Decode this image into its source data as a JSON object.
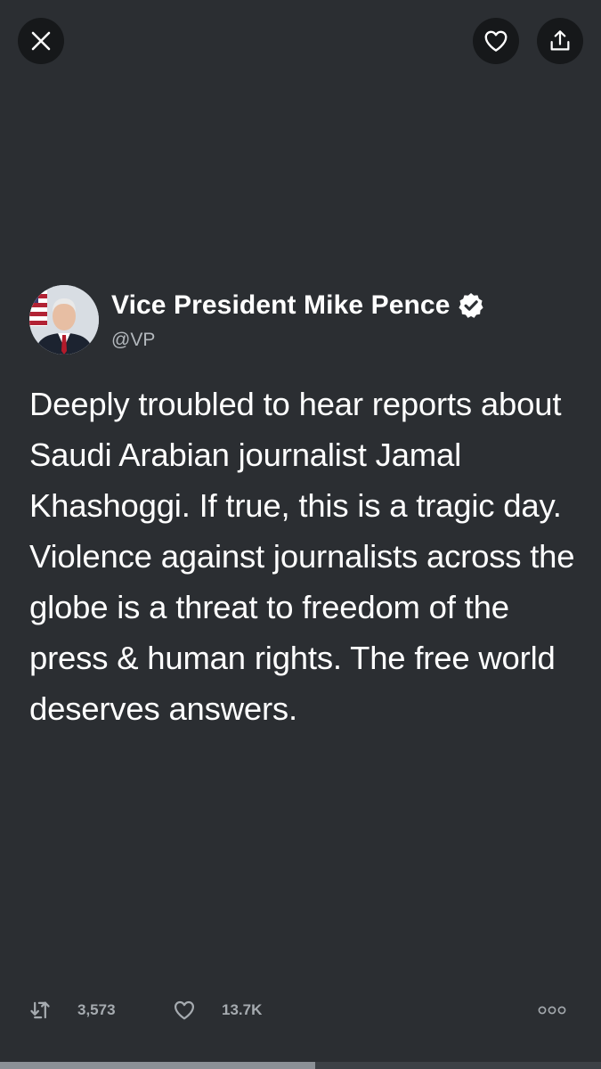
{
  "header": {
    "close_icon": "close-icon",
    "like_icon": "heart-icon",
    "share_icon": "share-icon"
  },
  "tweet": {
    "author": {
      "display_name": "Vice President Mike Pence",
      "handle": "@VP",
      "verified": true
    },
    "text": "Deeply troubled to hear reports about Saudi Arabian journalist Jamal Khashoggi. If true, this is a tragic day. Violence against journalists across the globe is a threat to freedom of the press & human rights. The free world deserves answers."
  },
  "actions": {
    "retweet_count": "3,573",
    "like_count": "13.7K",
    "more_icon": "more-icon"
  },
  "progress": {
    "fraction": 0.525
  },
  "colors": {
    "background": "#2b2e32",
    "button_bg": "#16181a",
    "text": "#ffffff",
    "secondary_text": "#b3b8bd"
  }
}
